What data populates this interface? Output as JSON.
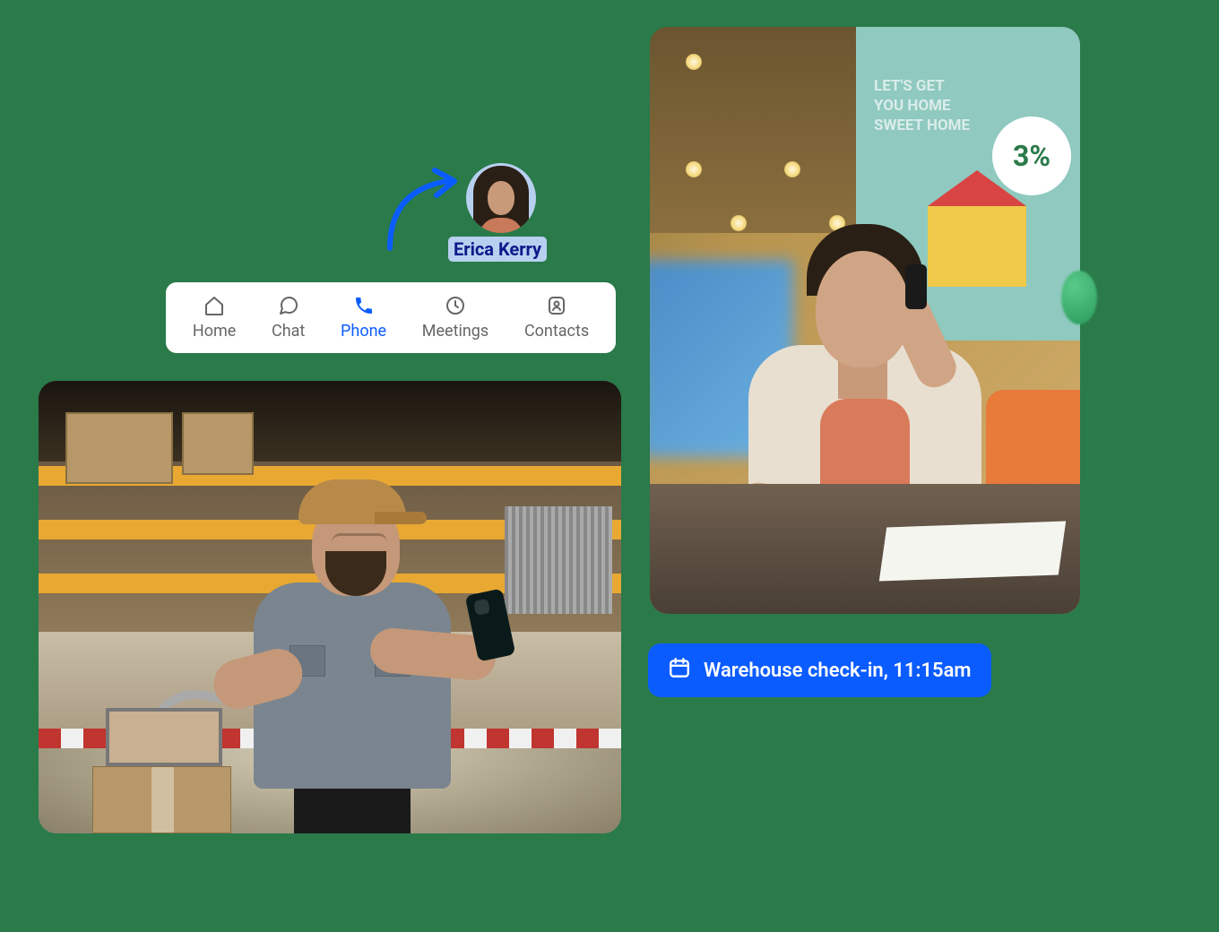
{
  "contact": {
    "name": "Erica Kerry"
  },
  "nav": {
    "items": [
      {
        "label": "Home",
        "icon": "home-icon",
        "active": false
      },
      {
        "label": "Chat",
        "icon": "chat-icon",
        "active": false
      },
      {
        "label": "Phone",
        "icon": "phone-icon",
        "active": true
      },
      {
        "label": "Meetings",
        "icon": "clock-icon",
        "active": false
      },
      {
        "label": "Contacts",
        "icon": "contacts-icon",
        "active": false
      }
    ]
  },
  "calendar_event": {
    "label": "Warehouse check-in, 11:15am"
  },
  "office_poster": {
    "line1": "LET'S GET",
    "line2": "YOU HOME",
    "line3": "SWEET HOME",
    "pct": "3%"
  }
}
